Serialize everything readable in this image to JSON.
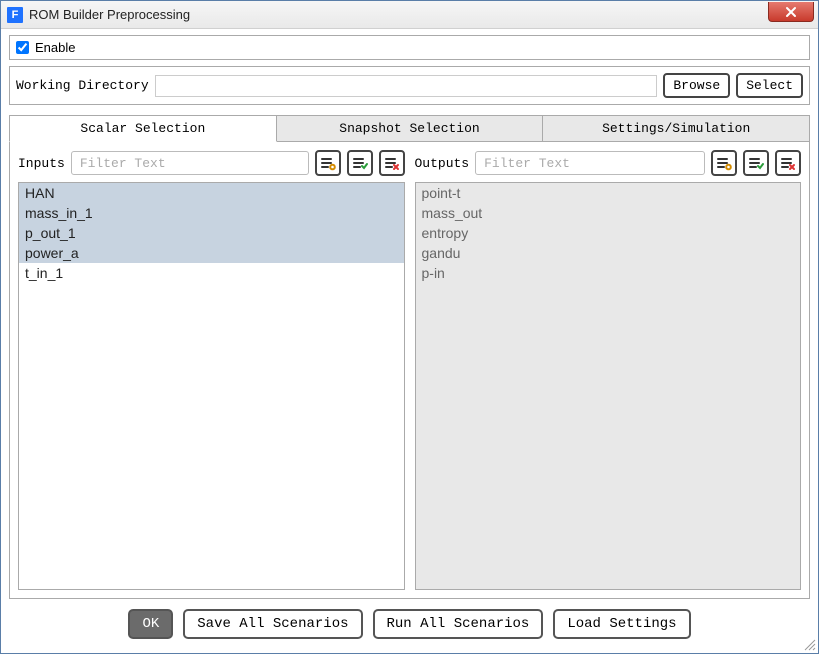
{
  "window": {
    "title": "ROM Builder Preprocessing",
    "app_icon_letter": "F"
  },
  "enable": {
    "label": "Enable",
    "checked": true
  },
  "working_directory": {
    "label": "Working Directory",
    "value": "",
    "browse_label": "Browse",
    "select_label": "Select"
  },
  "tabs": [
    {
      "label": "Scalar Selection",
      "active": true
    },
    {
      "label": "Snapshot Selection",
      "active": false
    },
    {
      "label": "Settings/Simulation",
      "active": false
    }
  ],
  "inputs_panel": {
    "title": "Inputs",
    "filter_placeholder": "Filter Text",
    "items": [
      {
        "label": "HAN",
        "selected": true
      },
      {
        "label": "mass_in_1",
        "selected": true
      },
      {
        "label": "p_out_1",
        "selected": true
      },
      {
        "label": "power_a",
        "selected": true
      },
      {
        "label": "t_in_1",
        "selected": false
      }
    ]
  },
  "outputs_panel": {
    "title": "Outputs",
    "filter_placeholder": "Filter Text",
    "items": [
      {
        "label": "point-t"
      },
      {
        "label": "mass_out"
      },
      {
        "label": "entropy"
      },
      {
        "label": "gandu"
      },
      {
        "label": "p-in"
      }
    ]
  },
  "footer": {
    "ok": "OK",
    "save_all": "Save All Scenarios",
    "run_all": "Run All Scenarios",
    "load": "Load Settings"
  }
}
